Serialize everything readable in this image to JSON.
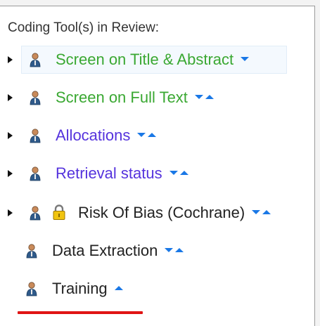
{
  "header": {
    "title": "Coding Tool(s) in Review:"
  },
  "colors": {
    "screening": "#3aa832",
    "coding": "#5533dd",
    "plain": "#222222",
    "arrows": "#1a78e6",
    "underline": "#e01414"
  },
  "tools": [
    {
      "label": "Screen on Title & Abstract",
      "color": "screening",
      "arrows": "down",
      "expandable": true,
      "locked": false,
      "selected": true
    },
    {
      "label": "Screen on Full Text",
      "color": "screening",
      "arrows": "down-up",
      "expandable": true,
      "locked": false,
      "selected": false
    },
    {
      "label": "Allocations",
      "color": "coding",
      "arrows": "down-up",
      "expandable": true,
      "locked": false,
      "selected": false
    },
    {
      "label": "Retrieval status",
      "color": "coding",
      "arrows": "down-up",
      "expandable": true,
      "locked": false,
      "selected": false
    },
    {
      "label": "Risk Of Bias (Cochrane)",
      "color": "plain",
      "arrows": "down-up",
      "expandable": true,
      "locked": true,
      "selected": false
    },
    {
      "label": "Data Extraction",
      "color": "plain",
      "arrows": "down-up",
      "expandable": false,
      "locked": false,
      "selected": false
    },
    {
      "label": "Training",
      "color": "plain",
      "arrows": "up",
      "expandable": false,
      "locked": false,
      "selected": false
    }
  ]
}
